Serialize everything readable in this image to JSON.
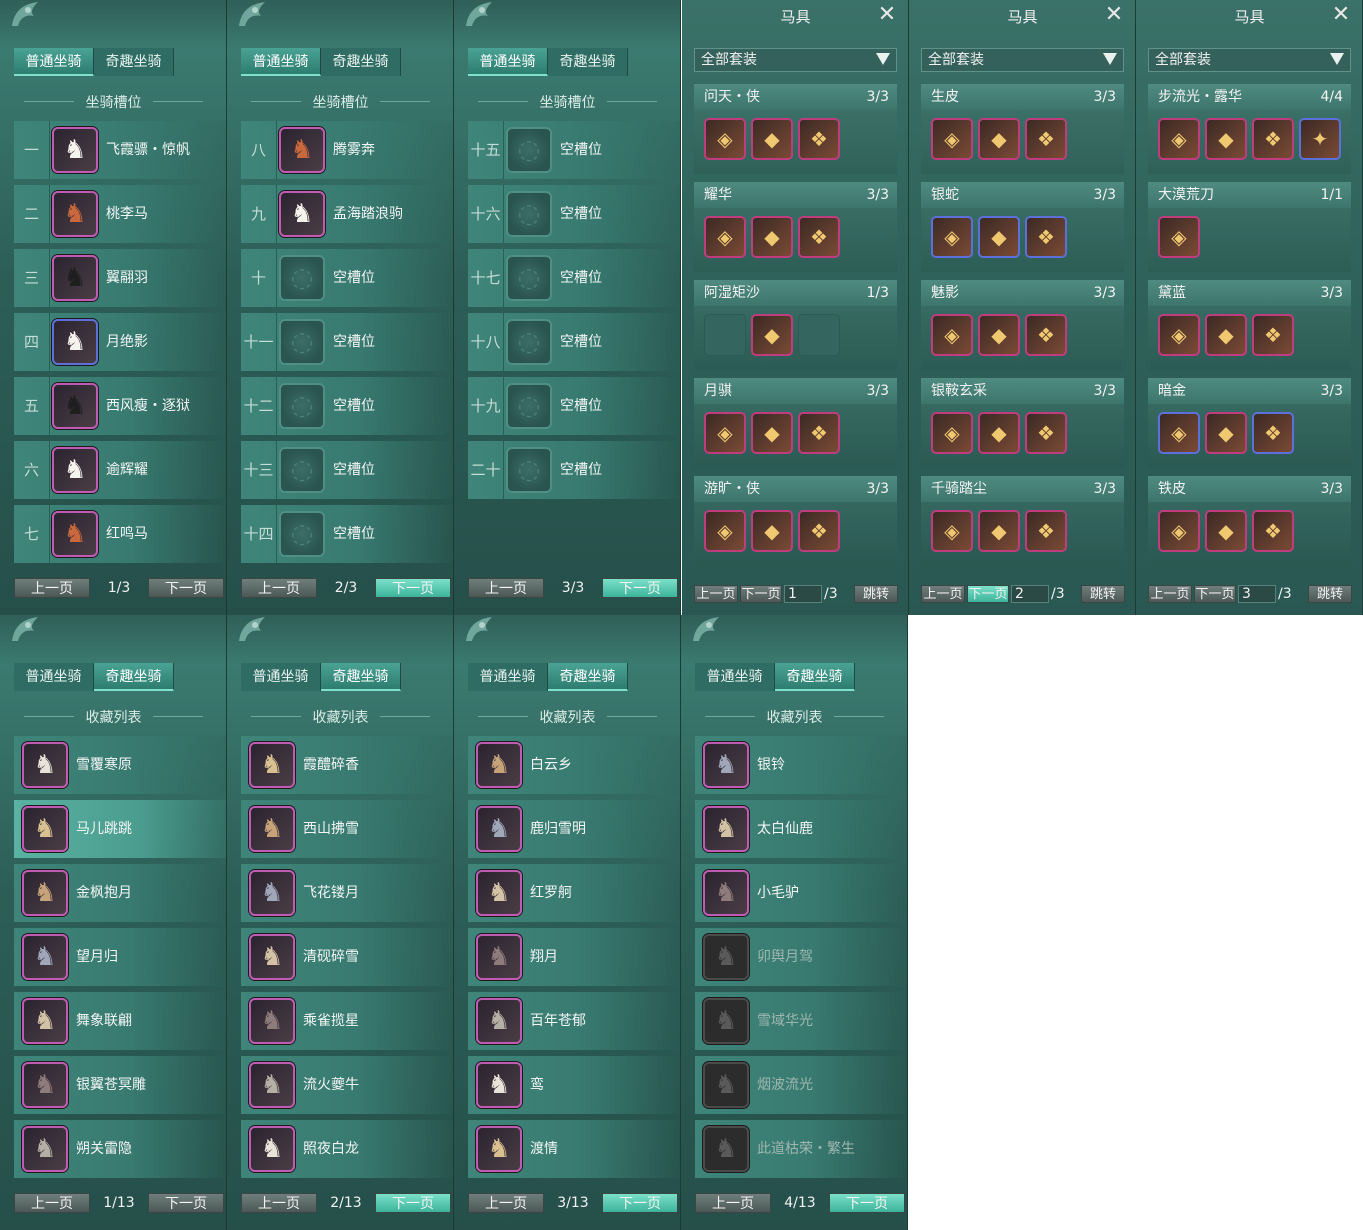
{
  "tabs": {
    "normal": "普通坐骑",
    "fun": "奇趣坐骑"
  },
  "pager": {
    "prev": "上一页",
    "next": "下一页"
  },
  "slots_panels": [
    {
      "section": "坐骑槽位",
      "page": "1/3",
      "rows": [
        {
          "num": "一",
          "name": "飞霞骠・惊帆",
          "icon": "white-horse-icon"
        },
        {
          "num": "二",
          "name": "桃李马",
          "icon": "chestnut-horse-icon"
        },
        {
          "num": "三",
          "name": "翼翮羽",
          "icon": "black-horse-icon"
        },
        {
          "num": "四",
          "name": "月绝影",
          "icon": "white-horse-icon"
        },
        {
          "num": "五",
          "name": "西风瘦・逐狱",
          "icon": "black-horse-icon"
        },
        {
          "num": "六",
          "name": "逾辉耀",
          "icon": "white-horse-icon"
        },
        {
          "num": "七",
          "name": "红鸣马",
          "icon": "chestnut-horse-icon"
        }
      ]
    },
    {
      "section": "坐骑槽位",
      "page": "2/3",
      "rows": [
        {
          "num": "八",
          "name": "腾雾奔",
          "icon": "chestnut-horse-icon"
        },
        {
          "num": "九",
          "name": "孟海踏浪驹",
          "icon": "white-horse-icon"
        },
        {
          "num": "十",
          "name": "空槽位",
          "icon": "empty-slot-icon"
        },
        {
          "num": "十一",
          "name": "空槽位",
          "icon": "empty-slot-icon"
        },
        {
          "num": "十二",
          "name": "空槽位",
          "icon": "empty-slot-icon"
        },
        {
          "num": "十三",
          "name": "空槽位",
          "icon": "empty-slot-icon"
        },
        {
          "num": "十四",
          "name": "空槽位",
          "icon": "empty-slot-icon"
        }
      ]
    },
    {
      "section": "坐骑槽位",
      "page": "3/3",
      "rows": [
        {
          "num": "十五",
          "name": "空槽位",
          "icon": "empty-slot-icon"
        },
        {
          "num": "十六",
          "name": "空槽位",
          "icon": "empty-slot-icon"
        },
        {
          "num": "十七",
          "name": "空槽位",
          "icon": "empty-slot-icon"
        },
        {
          "num": "十八",
          "name": "空槽位",
          "icon": "empty-slot-icon"
        },
        {
          "num": "十九",
          "name": "空槽位",
          "icon": "empty-slot-icon"
        },
        {
          "num": "二十",
          "name": "空槽位",
          "icon": "empty-slot-icon"
        }
      ]
    }
  ],
  "tack_panels": [
    {
      "title": "马具",
      "filter": "全部套装",
      "page_input": "1",
      "total": "/3",
      "jump": "跳转",
      "sets": [
        {
          "name": "问天・侠",
          "count": "3/3",
          "items": 3
        },
        {
          "name": "耀华",
          "count": "3/3",
          "items": 3
        },
        {
          "name": "阿湿矩沙",
          "count": "1/3",
          "items": 3,
          "owned": [
            1
          ]
        },
        {
          "name": "月骐",
          "count": "3/3",
          "items": 3
        },
        {
          "name": "游旷・侠",
          "count": "3/3",
          "items": 3
        }
      ]
    },
    {
      "title": "马具",
      "filter": "全部套装",
      "page_input": "2",
      "total": "/3",
      "jump": "跳转",
      "sets": [
        {
          "name": "生皮",
          "count": "3/3",
          "items": 3
        },
        {
          "name": "银蛇",
          "count": "3/3",
          "items": 3
        },
        {
          "name": "魅影",
          "count": "3/3",
          "items": 3
        },
        {
          "name": "银鞍玄采",
          "count": "3/3",
          "items": 3
        },
        {
          "name": "千骑踏尘",
          "count": "3/3",
          "items": 3
        }
      ]
    },
    {
      "title": "马具",
      "filter": "全部套装",
      "page_input": "3",
      "total": "/3",
      "jump": "跳转",
      "sets": [
        {
          "name": "步流光・露华",
          "count": "4/4",
          "items": 4
        },
        {
          "name": "大漠荒刀",
          "count": "1/1",
          "items": 1
        },
        {
          "name": "黛蓝",
          "count": "3/3",
          "items": 3
        },
        {
          "name": "暗金",
          "count": "3/3",
          "items": 3
        },
        {
          "name": "铁皮",
          "count": "3/3",
          "items": 3
        }
      ]
    }
  ],
  "collection_panels": [
    {
      "section": "收藏列表",
      "page": "1/13",
      "items": [
        {
          "name": "雪覆寒原"
        },
        {
          "name": "马儿跳跳"
        },
        {
          "name": "金枫抱月"
        },
        {
          "name": "望月归"
        },
        {
          "name": "舞象联翩"
        },
        {
          "name": "银翼苍冥雕"
        },
        {
          "name": "朔关雷隐"
        }
      ]
    },
    {
      "section": "收藏列表",
      "page": "2/13",
      "items": [
        {
          "name": "霞醴碎香"
        },
        {
          "name": "西山拂雪"
        },
        {
          "name": "飞花镂月"
        },
        {
          "name": "清砚碎雪"
        },
        {
          "name": "乘雀揽星"
        },
        {
          "name": "流火夔牛"
        },
        {
          "name": "照夜白龙"
        }
      ]
    },
    {
      "section": "收藏列表",
      "page": "3/13",
      "items": [
        {
          "name": "白云乡"
        },
        {
          "name": "鹿归雪明"
        },
        {
          "name": "红罗舸"
        },
        {
          "name": "翔月"
        },
        {
          "name": "百年苍郁"
        },
        {
          "name": "鸾"
        },
        {
          "name": "渡情"
        }
      ]
    },
    {
      "section": "收藏列表",
      "page": "4/13",
      "items": [
        {
          "name": "银铃"
        },
        {
          "name": "太白仙鹿"
        },
        {
          "name": "小毛驴"
        },
        {
          "name": "卯舆月驾"
        },
        {
          "name": "雪域华光"
        },
        {
          "name": "烟波流光"
        },
        {
          "name": "此道枯荣・繁生"
        }
      ]
    }
  ]
}
